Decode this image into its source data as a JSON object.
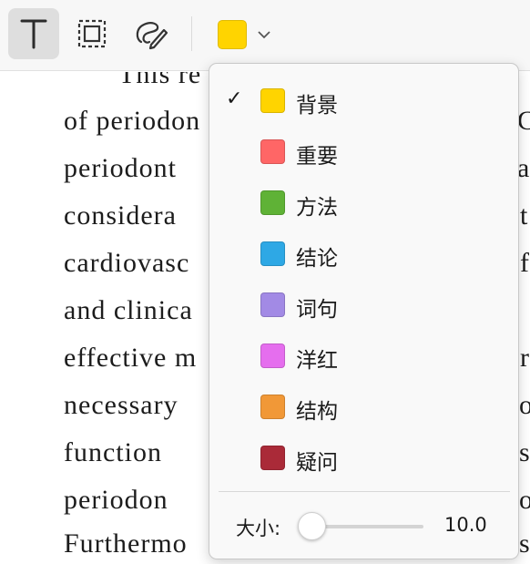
{
  "toolbar": {
    "tools": [
      {
        "name": "text-tool",
        "icon": "text-T-icon",
        "active": true
      },
      {
        "name": "area-select-tool",
        "icon": "dashed-rectangle-icon",
        "active": false
      },
      {
        "name": "draw-tool",
        "icon": "pen-scribble-icon",
        "active": false
      }
    ],
    "current_color": "#FFD400"
  },
  "document": {
    "lines": [
      "This re",
      "of periodon",
      "periodont",
      "considera",
      "cardiovasc",
      "and clinica",
      "effective m",
      "necessary",
      "function",
      "periodon",
      "Furthermo"
    ],
    "right_edge_fragments": [
      "C",
      "a",
      "t",
      "f",
      "r",
      "o",
      "s",
      "o",
      "s"
    ]
  },
  "color_menu": {
    "items": [
      {
        "label": "背景",
        "color": "#FFD400",
        "checked": true
      },
      {
        "label": "重要",
        "color": "#FF6666",
        "checked": false
      },
      {
        "label": "方法",
        "color": "#5FB236",
        "checked": false
      },
      {
        "label": "结论",
        "color": "#2EA8E5",
        "checked": false
      },
      {
        "label": "词句",
        "color": "#A28AE5",
        "checked": false
      },
      {
        "label": "洋红",
        "color": "#E56EEE",
        "checked": false
      },
      {
        "label": "结构",
        "color": "#F19837",
        "checked": false
      },
      {
        "label": "疑问",
        "color": "#AA2A38",
        "checked": false
      }
    ],
    "check_mark": "✓",
    "size_label": "大小:",
    "size_value": "10.0",
    "size_slider_fraction": 0.0
  }
}
